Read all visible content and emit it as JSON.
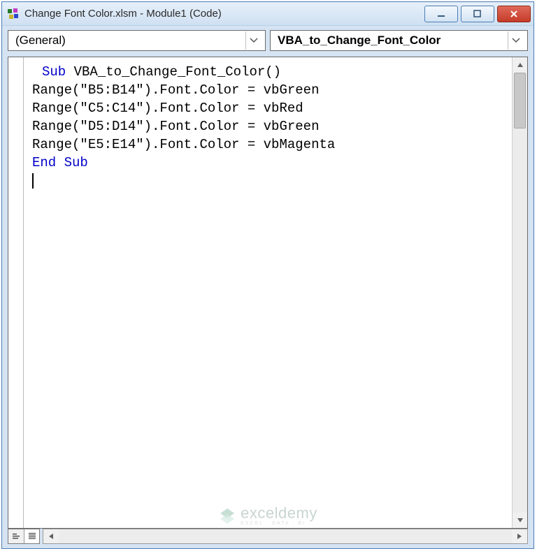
{
  "window": {
    "title": "Change Font Color.xlsm - Module1 (Code)"
  },
  "dropdowns": {
    "object": "(General)",
    "procedure": "VBA_to_Change_Font_Color"
  },
  "code": {
    "sub_kw": "Sub",
    "sub_name": " VBA_to_Change_Font_Color()",
    "lines": [
      "Range(\"B5:B14\").Font.Color = vbGreen",
      "Range(\"C5:C14\").Font.Color = vbRed",
      "Range(\"D5:D14\").Font.Color = vbGreen",
      "Range(\"E5:E14\").Font.Color = vbMagenta"
    ],
    "end_kw": "End Sub"
  },
  "watermark": {
    "brand": "exceldemy",
    "tagline": "EXCEL · DATA · BI"
  }
}
